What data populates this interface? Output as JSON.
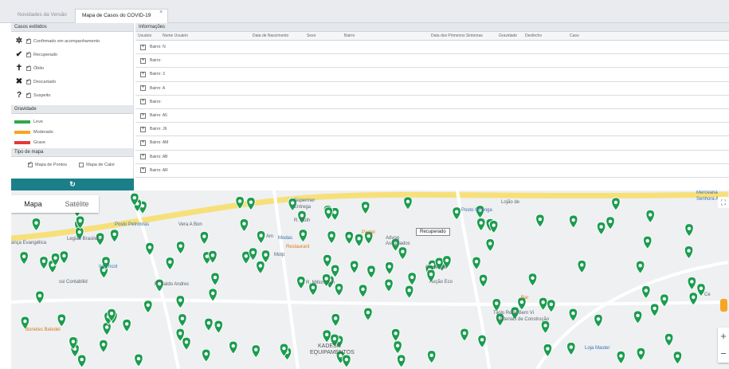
{
  "tabs": {
    "tab1": "Novidades da Versão",
    "tab2": "Mapa de Casos do COVID-19",
    "close": "×"
  },
  "left_panel": {
    "cases_title": "Casos exibidos",
    "statuses": [
      {
        "icon": "virus-icon",
        "glyph": "✲",
        "label": "Confirmado em acompanhamento"
      },
      {
        "icon": "check-icon",
        "glyph": "✔",
        "label": "Recuperado"
      },
      {
        "icon": "cross-grave-icon",
        "glyph": "✝",
        "label": "Óbito"
      },
      {
        "icon": "x-mark-icon",
        "glyph": "✖",
        "label": "Descartado"
      },
      {
        "icon": "question-icon",
        "glyph": "?",
        "label": "Suspeito"
      }
    ],
    "severity_title": "Gravidade",
    "severities": [
      {
        "label": "Leve",
        "color": "#2fa84f"
      },
      {
        "label": "Moderado",
        "color": "#f5a623"
      },
      {
        "label": "Grave",
        "color": "#e53935"
      }
    ],
    "map_type_title": "Tipo de mapa",
    "map_types": [
      {
        "label": "Mapa de Pontos",
        "checked": true
      },
      {
        "label": "Mapa de Calor",
        "checked": false
      }
    ],
    "refresh_glyph": "↻"
  },
  "info_panel": {
    "title": "Informações",
    "columns": [
      "Usuário",
      "Nome Usuário",
      "Data de Nascimento",
      "Sexo",
      "Bairro",
      "Data dos Primeiros Sintomas",
      "Gravidade",
      "Desfecho",
      "Caso"
    ],
    "rows": [
      "Bairro: N",
      "Bairro:",
      "Bairro: 3",
      "Bairro: A",
      "Bairro:",
      "Bairro: A5",
      "Bairro: J6",
      "Bairro: AM",
      "Bairro: AB",
      "Bairro: AR"
    ]
  },
  "map": {
    "type_map": "Mapa",
    "type_satellite": "Satélite",
    "tooltip": "Recuperado",
    "zoom_in": "+",
    "zoom_out": "−",
    "fullscreen": "⛶",
    "pin_color": "#1c9c4f",
    "road_color": "#f7e07a",
    "labels": [
      {
        "text": "Posto Petrobras",
        "cls": "blue"
      },
      {
        "text": "Vera A Bon",
        "cls": ""
      },
      {
        "text": "Legião Brasileira",
        "cls": ""
      },
      {
        "text": "ança Evangélica",
        "cls": ""
      },
      {
        "text": "Ira Tricot",
        "cls": "blue"
      },
      {
        "text": "ssi Contabilid",
        "cls": ""
      },
      {
        "text": "Am",
        "cls": ""
      },
      {
        "text": "Modas",
        "cls": "blue"
      },
      {
        "text": "Restaurant",
        "cls": "orange"
      },
      {
        "text": "Motp",
        "cls": ""
      },
      {
        "text": "R. Ruth",
        "cls": ""
      },
      {
        "text": "Supermer",
        "cls": "blue"
      },
      {
        "text": "Entrega",
        "cls": ""
      },
      {
        "text": "Pastel",
        "cls": "orange"
      },
      {
        "text": "Advog",
        "cls": ""
      },
      {
        "text": "Associados",
        "cls": ""
      },
      {
        "text": "Posto Ipiranga",
        "cls": "blue"
      },
      {
        "text": "Lojão de",
        "cls": ""
      },
      {
        "text": "Aução Eco",
        "cls": ""
      },
      {
        "text": "Comercial",
        "cls": ""
      },
      {
        "text": "R. Saldo Andrec",
        "cls": ""
      },
      {
        "text": "R. Milton Ban",
        "cls": ""
      },
      {
        "text": "KADESH",
        "cls": "big"
      },
      {
        "text": "EQUIPAMENTOS",
        "cls": "big"
      },
      {
        "text": "Tijolo Rede Bem Vi",
        "cls": ""
      },
      {
        "text": "Materiais de Construção",
        "cls": ""
      },
      {
        "text": "Loja Master",
        "cls": "blue"
      },
      {
        "text": "Mercearia",
        "cls": "blue"
      },
      {
        "text": "Senhora Ap",
        "cls": "blue"
      },
      {
        "text": "Bonetes Beledel",
        "cls": "orange"
      },
      {
        "text": "Bar",
        "cls": "orange"
      },
      {
        "text": "Ce",
        "cls": ""
      }
    ]
  }
}
